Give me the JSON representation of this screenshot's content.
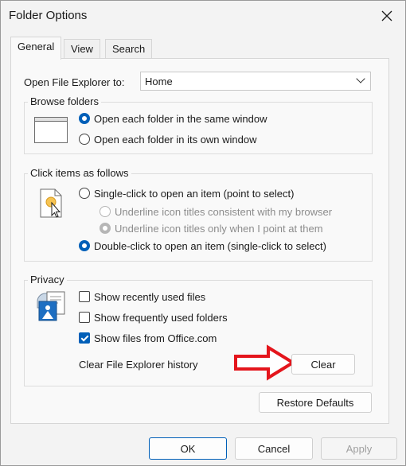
{
  "window": {
    "title": "Folder Options"
  },
  "tabs": [
    {
      "label": "General",
      "active": true
    },
    {
      "label": "View",
      "active": false
    },
    {
      "label": "Search",
      "active": false
    }
  ],
  "general": {
    "open_explorer_label": "Open File Explorer to:",
    "open_explorer_value": "Home",
    "browse_folders": {
      "title": "Browse folders",
      "options": [
        {
          "label": "Open each folder in the same window",
          "checked": true
        },
        {
          "label": "Open each folder in its own window",
          "checked": false
        }
      ]
    },
    "click_items": {
      "title": "Click items as follows",
      "single_click": "Single-click to open an item (point to select)",
      "underline_browser": "Underline icon titles consistent with my browser",
      "underline_point": "Underline icon titles only when I point at them",
      "double_click": "Double-click to open an item (single-click to select)"
    },
    "privacy": {
      "title": "Privacy",
      "options": [
        {
          "label": "Show recently used files",
          "checked": false
        },
        {
          "label": "Show frequently used folders",
          "checked": false
        },
        {
          "label": "Show files from Office.com",
          "checked": true
        }
      ],
      "clear_history_label": "Clear File Explorer history",
      "clear_button": "Clear"
    },
    "restore_defaults": "Restore Defaults"
  },
  "footer": {
    "ok": "OK",
    "cancel": "Cancel",
    "apply": "Apply"
  },
  "colors": {
    "accent": "#005fb8",
    "annotation_arrow": "#e4151c"
  }
}
